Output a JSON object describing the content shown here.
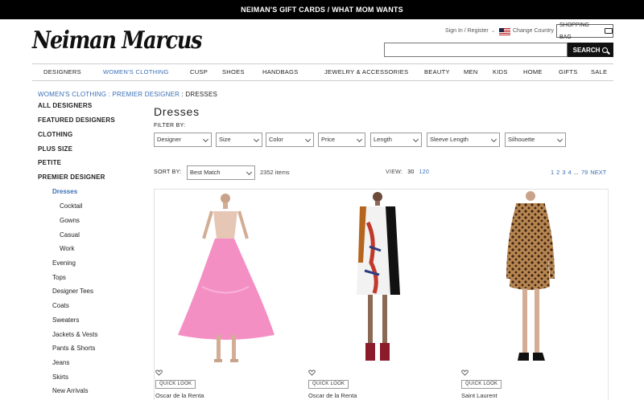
{
  "promo": "NEIMAN'S GIFT CARDS / WHAT MOM WANTS",
  "logo": "Neiman Marcus",
  "utility": {
    "sign_in": "Sign In / Register",
    "change_country": "Change Country",
    "shopping_bag": "SHOPPING BAG"
  },
  "search": {
    "value": "",
    "button": "SEARCH"
  },
  "nav": [
    "DESIGNERS",
    "WOMEN'S CLOTHING",
    "CUSP",
    "SHOES",
    "HANDBAGS",
    "JEWELRY & ACCESSORIES",
    "BEAUTY",
    "MEN",
    "KIDS",
    "HOME",
    "GIFTS",
    "SALE"
  ],
  "nav_active": "WOMEN'S CLOTHING",
  "breadcrumb": {
    "link": "WOMEN'S CLOTHING : PREMIER DESIGNER",
    "sep": " : ",
    "current": "DRESSES"
  },
  "sidebar": [
    "ALL DESIGNERS",
    "FEATURED DESIGNERS",
    "CLOTHING",
    "PLUS SIZE",
    "PETITE",
    "PREMIER DESIGNER",
    "Dresses",
    "Cocktail",
    "Gowns",
    "Casual",
    "Work",
    "Evening",
    "Tops",
    "Designer Tees",
    "Coats",
    "Sweaters",
    "Jackets & Vests",
    "Pants & Shorts",
    "Jeans",
    "Skirts",
    "New Arrivals"
  ],
  "page_title": "Dresses",
  "filter_label": "FILTER BY:",
  "filters": [
    "Designer",
    "Size",
    "Color",
    "Price",
    "Length",
    "Sleeve Length",
    "Silhouette"
  ],
  "sort": {
    "label": "SORT BY:",
    "selected": "Best Match",
    "count": "2352 items"
  },
  "view": {
    "label": "VIEW:",
    "opt1": "30",
    "opt2": "120"
  },
  "pagination": [
    "1",
    "2",
    "3",
    "4",
    "...",
    "79",
    "NEXT"
  ],
  "products": [
    {
      "designer": "Oscar de la Renta",
      "quick_look": "QUICK LOOK"
    },
    {
      "designer": "Oscar de la Renta",
      "quick_look": "QUICK LOOK"
    },
    {
      "designer": "Saint Laurent",
      "quick_look": "QUICK LOOK"
    }
  ],
  "colors": {
    "link_blue": "#3a6fb5",
    "promo_bg": "#000000"
  }
}
